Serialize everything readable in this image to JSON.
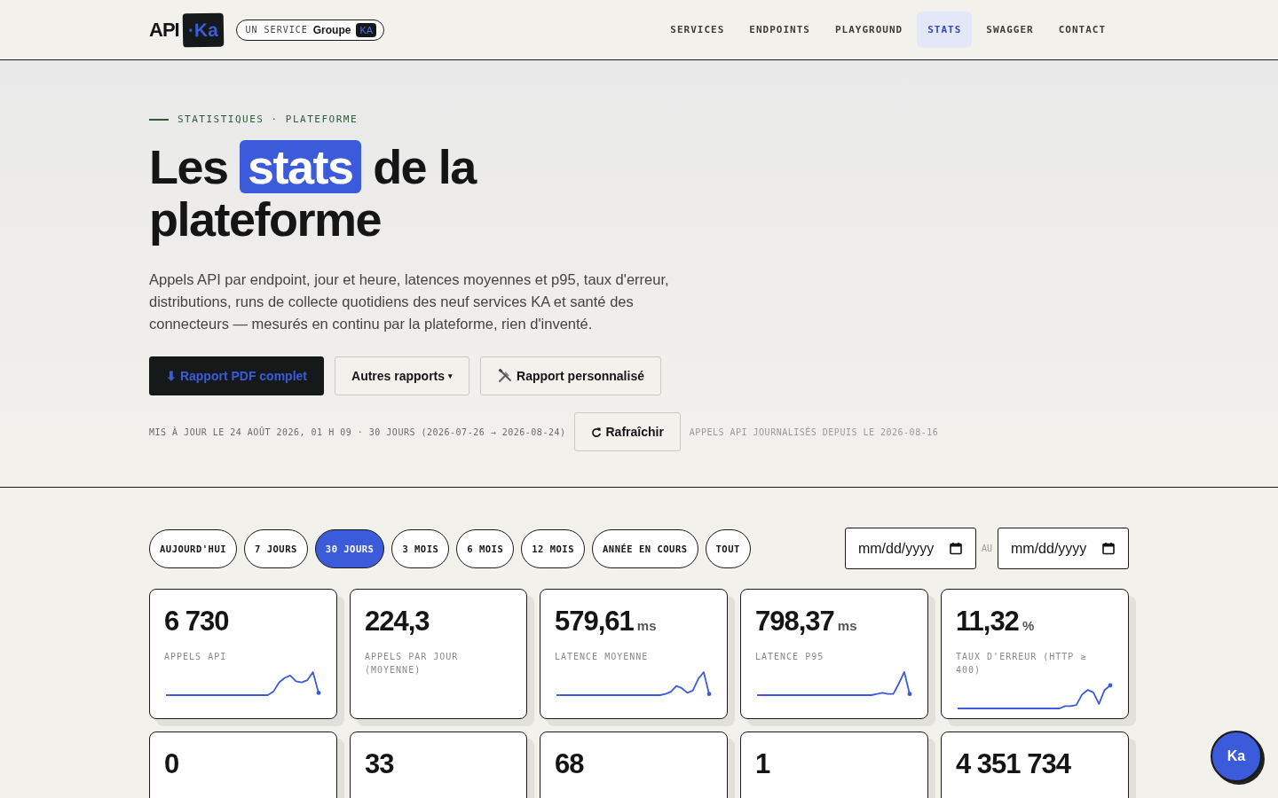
{
  "header": {
    "logo": {
      "text": "API",
      "badge": "·Ka"
    },
    "service_pill": {
      "label": "UN SERVICE",
      "brand": "Groupe",
      "brand_badge": "KA"
    },
    "nav": [
      {
        "label": "SERVICES",
        "selected": false
      },
      {
        "label": "ENDPOINTS",
        "selected": false
      },
      {
        "label": "PLAYGROUND",
        "selected": false
      },
      {
        "label": "STATS",
        "selected": true
      },
      {
        "label": "SWAGGER",
        "selected": false
      },
      {
        "label": "CONTACT",
        "selected": false
      }
    ]
  },
  "hero": {
    "eyebrow": "STATISTIQUES · PLATEFORME",
    "title_before": "Les",
    "title_highlight": "stats",
    "title_after": "de la plateforme",
    "description": "Appels API par endpoint, jour et heure, latences moyennes et p95, taux d'erreur, distributions, runs de collecte quotidiens des neuf services KA et santé des connecteurs — mesurés en continu par la plateforme, rien d'inventé.",
    "buttons": [
      {
        "kind": "primary",
        "label": "⬇ Rapport PDF complet"
      },
      {
        "kind": "dropdown",
        "label": "Autres rapports",
        "caret": "▾"
      },
      {
        "kind": "tools",
        "label": "Rapport personnalisé"
      }
    ],
    "updated": "MIS À JOUR LE 24 AOÛT 2026, 01 H 09 · 30 JOURS (2026-07-26 → 2026-08-24)",
    "refresh": "Rafraîchir",
    "logged_since": "APPELS API JOURNALISÉS DEPUIS LE 2026-08-16"
  },
  "filters": {
    "periods": [
      {
        "label": "AUJOURD'HUI",
        "selected": false
      },
      {
        "label": "7 JOURS",
        "selected": false
      },
      {
        "label": "30 JOURS",
        "selected": true
      },
      {
        "label": "3 MOIS",
        "selected": false
      },
      {
        "label": "6 MOIS",
        "selected": false
      },
      {
        "label": "12 MOIS",
        "selected": false
      },
      {
        "label": "ANNÉE EN COURS",
        "selected": false
      },
      {
        "label": "TOUT",
        "selected": false
      }
    ],
    "date_from": {
      "placeholder": "mm/dd/yyyy"
    },
    "separator": "AU",
    "date_to": {
      "placeholder": "mm/dd/yyyy"
    }
  },
  "stats": [
    {
      "value": "6 730",
      "label": "APPELS API",
      "sparkline": true
    },
    {
      "value": "224,3",
      "label": "APPELS PAR JOUR (MOYENNE)",
      "sparkline": false
    },
    {
      "value": "579,61",
      "unit": "ms",
      "label": "LATENCE MOYENNE",
      "sparkline": true
    },
    {
      "value": "798,37",
      "unit": "ms",
      "label": "LATENCE P95",
      "sparkline": true
    },
    {
      "value": "11,32",
      "unit": "%",
      "label": "TAUX D'ERREUR (HTTP ≥ 400)",
      "sparkline": true
    },
    {
      "value": "0",
      "sparkline": false
    },
    {
      "value": "33",
      "sparkline": false
    },
    {
      "value": "68",
      "sparkline": false
    },
    {
      "value": "1",
      "sparkline": false
    },
    {
      "value": "4 351 734",
      "sparkline": false
    }
  ],
  "chat_button": "Ka"
}
